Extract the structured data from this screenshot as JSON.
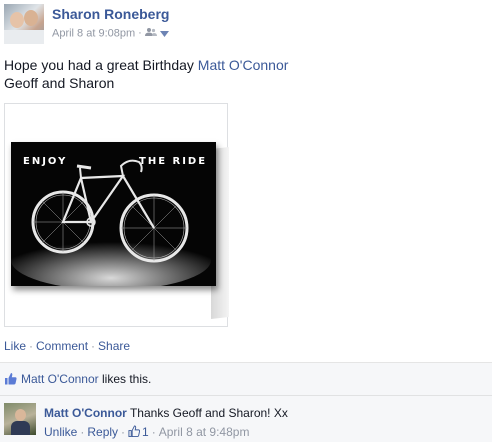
{
  "post": {
    "author": "Sharon Roneberg",
    "timestamp": "April 8 at 9:08pm",
    "audience_icon": "friends-icon",
    "text_prefix": "Hope you had a great Birthday ",
    "mention": "Matt O'Connor",
    "text_line2": "Geoff and Sharon",
    "photo": {
      "card_left_text": "ENJOY",
      "card_right_text": "THE RIDE"
    },
    "actions": {
      "like": "Like",
      "comment": "Comment",
      "share": "Share",
      "separator": "·"
    }
  },
  "likes": {
    "name": "Matt O'Connor",
    "suffix": " likes this."
  },
  "comment": {
    "author": "Matt O'Connor",
    "text": "Thanks Geoff and Sharon! Xx",
    "unlike": "Unlike",
    "reply": "Reply",
    "like_count": "1",
    "timestamp": "April 8 at 9:48pm"
  },
  "colors": {
    "link": "#3b5998",
    "meta": "#9197a3",
    "ufi_background": "#f6f7f9"
  }
}
